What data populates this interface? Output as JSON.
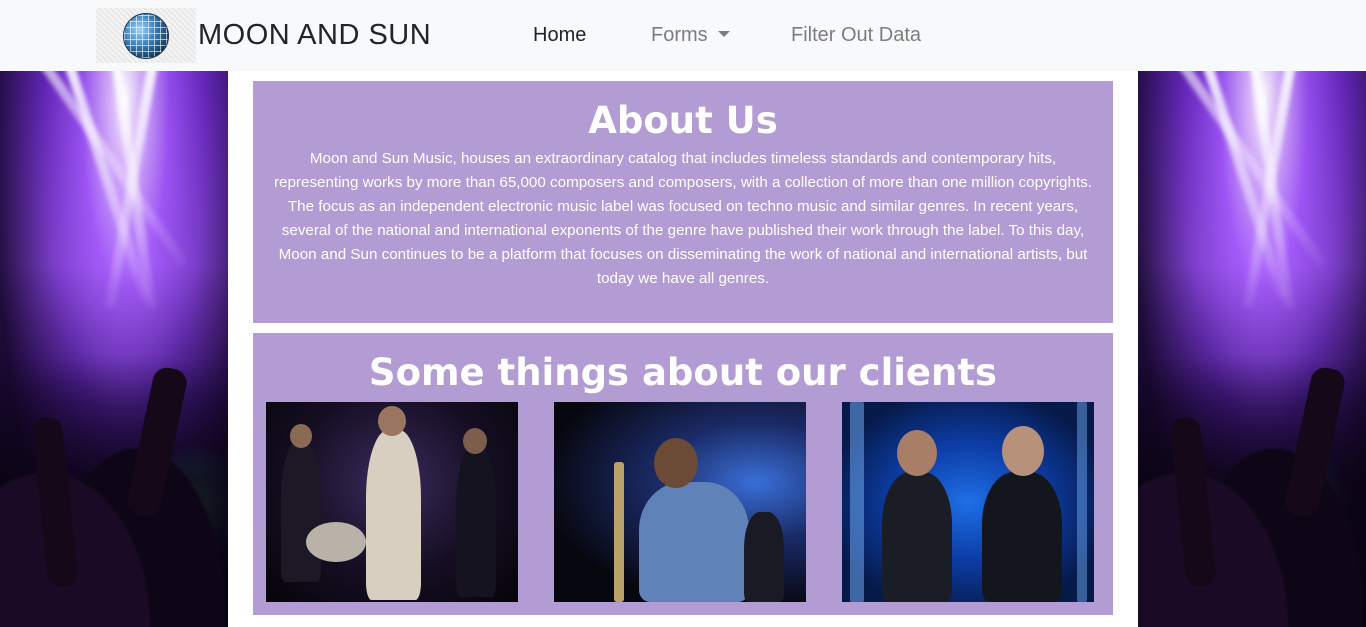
{
  "navbar": {
    "brand_text": "MOON AND SUN",
    "logo_icon": "disco-ball-icon",
    "links": [
      {
        "label": "Home",
        "active": true
      },
      {
        "label": "Forms",
        "dropdown": true
      },
      {
        "label": "Filter Out Data"
      }
    ]
  },
  "about": {
    "title": "About Us",
    "body": "Moon and Sun Music, houses an extraordinary catalog that includes timeless standards and contemporary hits, representing works by more than 65,000 composers and composers, with a collection of more than one million copyrights. The focus as an independent electronic music label was focused on techno music and similar genres. In recent years, several of the national and international exponents of the genre have published their work through the label. To this day, Moon and Sun continues to be a platform that focuses on disseminating the work of national and international artists, but today we have all genres."
  },
  "clients": {
    "title": "Some things about our clients",
    "photos": [
      "band-performing-photo",
      "singer-on-stage-photo",
      "duo-performing-photo"
    ]
  },
  "colors": {
    "navbar_bg": "#f8f9fa",
    "panel_bg": "#b39bd3",
    "panel_text": "#ffffff"
  }
}
